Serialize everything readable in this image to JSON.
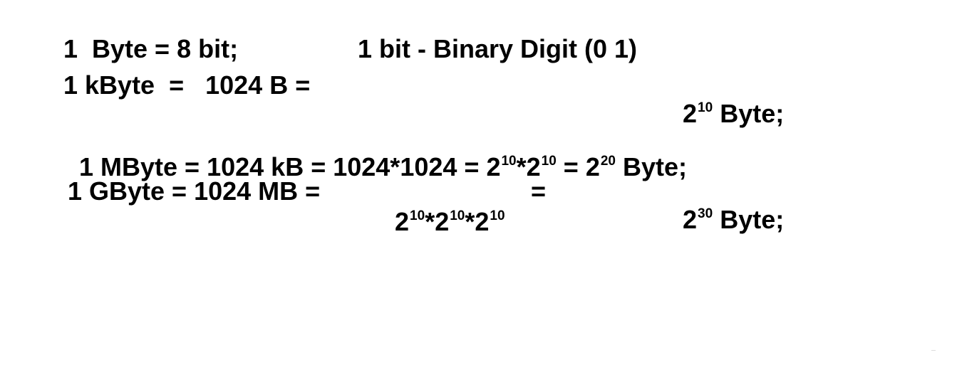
{
  "line1": {
    "left": "1  Byte = 8 bit;",
    "right": "1 bit - Binary Digit (0 1)"
  },
  "line2": {
    "left": "1 kByte  =   1024 B =",
    "pow_base": "2",
    "pow_exp": "10",
    "unit": " Byte;"
  },
  "line3": {
    "left": "1 MByte = 1024 kB = 1024*1024 = ",
    "t1_base": "2",
    "t1_exp": "10",
    "mul": "*",
    "t2_base": "2",
    "t2_exp": "10",
    "eq": " = ",
    "t3_base": "2",
    "t3_exp": "20",
    "unit": " Byte;"
  },
  "line4": {
    "left": "1 GByte = 1024 MB =",
    "t1_base": "2",
    "t1_exp": "10",
    "mul1": "*",
    "t2_base": "2",
    "t2_exp": "10",
    "mul2": "*",
    "t3_base": "2",
    "t3_exp": "10",
    "eq": "=",
    "res_base": "2",
    "res_exp": "30",
    "unit": " Byte;"
  }
}
